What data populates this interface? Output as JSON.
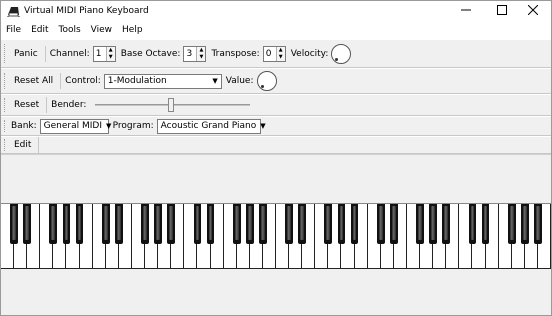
{
  "window": {
    "title": "Virtual MIDI Piano Keyboard"
  },
  "menu": [
    "File",
    "Edit",
    "Tools",
    "View",
    "Help"
  ],
  "toolbar1": {
    "panic_label": "Panic",
    "channel_label": "Channel:",
    "channel_value": "1",
    "base_octave_label": "Base Octave:",
    "base_octave_value": "3",
    "transpose_label": "Transpose:",
    "transpose_value": "0",
    "velocity_label": "Velocity:"
  },
  "toolbar2": {
    "reset_all_label": "Reset All",
    "control_label": "Control:",
    "control_value": "1-Modulation",
    "value_label": "Value:"
  },
  "toolbar3": {
    "reset_label": "Reset",
    "bender_label": "Bender:"
  },
  "toolbar4": {
    "bank_label": "Bank:",
    "bank_value": "General MIDI",
    "program_label": "Program:",
    "program_value": "Acoustic Grand Piano"
  },
  "toolbar5": {
    "edit_label": "Edit"
  },
  "keyboard": {
    "octaves": 6,
    "white_keys": 42
  },
  "icons": {
    "app": "piano-icon",
    "minimize": "minimize-icon",
    "maximize": "maximize-icon",
    "close": "close-icon",
    "dropdown": "chevron-down-icon"
  }
}
